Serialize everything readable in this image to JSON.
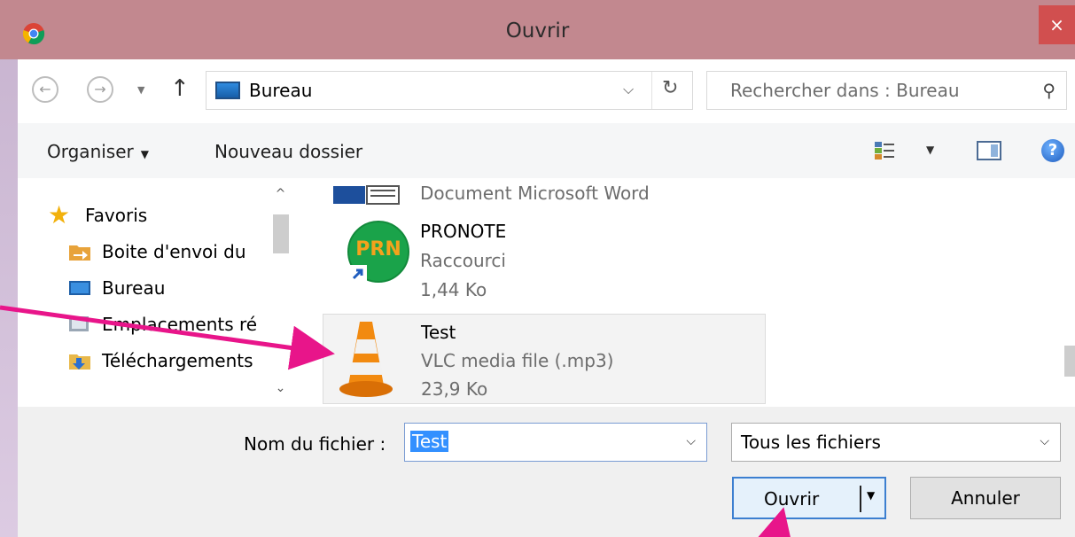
{
  "window": {
    "title": "Ouvrir",
    "close_glyph": "×"
  },
  "nav": {
    "back_glyph": "←",
    "forward_glyph": "→",
    "up_glyph": "↑",
    "address": "Bureau",
    "search_placeholder": "Rechercher dans : Bureau"
  },
  "toolbar": {
    "organiser": "Organiser",
    "nouveau_dossier": "Nouveau dossier",
    "help_glyph": "?"
  },
  "sidebar": {
    "items": [
      {
        "label": "Favoris",
        "icon": "star-icon"
      },
      {
        "label": "Boite d'envoi du",
        "icon": "folder-send-icon"
      },
      {
        "label": "Bureau",
        "icon": "desktop-icon"
      },
      {
        "label": "Emplacements ré",
        "icon": "recent-places-icon"
      },
      {
        "label": "Téléchargements",
        "icon": "downloads-icon"
      }
    ]
  },
  "files": [
    {
      "name": "",
      "type": "Document Microsoft Word",
      "size": "",
      "icon": "word-document-icon"
    },
    {
      "name": "PRONOTE",
      "type": "Raccourci",
      "size": "1,44 Ko",
      "icon": "pronote-shortcut-icon",
      "icon_text": "PRN"
    },
    {
      "name": "Test",
      "type": "VLC media file (.mp3)",
      "size": "23,9 Ko",
      "icon": "vlc-cone-icon",
      "selected": true
    }
  ],
  "footer": {
    "filename_label": "Nom du fichier :",
    "filename_value": "Test",
    "filetype_value": "Tous les fichiers",
    "open_button": "Ouvrir",
    "cancel_button": "Annuler"
  },
  "colors": {
    "titlebar": "#c2888f",
    "close": "#d14f4f",
    "annotation_arrow": "#e8158a",
    "selection": "#3390ff"
  }
}
